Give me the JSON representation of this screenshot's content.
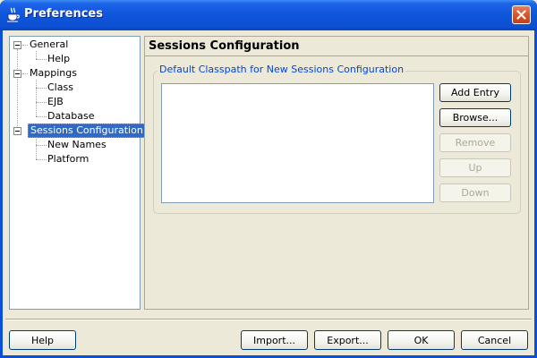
{
  "window": {
    "title": "Preferences",
    "icons": {
      "app": "java-cup-icon",
      "close": "close-icon"
    }
  },
  "tree": {
    "items": [
      {
        "label": "General",
        "expanded": true,
        "level": 0
      },
      {
        "label": "Help",
        "level": 1
      },
      {
        "label": "Mappings",
        "expanded": true,
        "level": 0
      },
      {
        "label": "Class",
        "level": 1
      },
      {
        "label": "EJB",
        "level": 1
      },
      {
        "label": "Database",
        "level": 1
      },
      {
        "label": "Sessions Configuration",
        "expanded": true,
        "level": 0,
        "selected": true
      },
      {
        "label": "New Names",
        "level": 1
      },
      {
        "label": "Platform",
        "level": 1
      }
    ]
  },
  "panel": {
    "title": "Sessions Configuration",
    "group": {
      "title": "Default Classpath for New Sessions Configuration",
      "entries": []
    },
    "buttons": {
      "add_entry": "Add Entry",
      "browse": "Browse...",
      "remove": "Remove",
      "up": "Up",
      "down": "Down"
    }
  },
  "footer": {
    "help": "Help",
    "import": "Import...",
    "export": "Export...",
    "ok": "OK",
    "cancel": "Cancel"
  },
  "colors": {
    "titlebar": "#0F55DA",
    "selection": "#316AC5",
    "group_title": "#0046D5",
    "dialog_bg": "#ECE9D8"
  }
}
